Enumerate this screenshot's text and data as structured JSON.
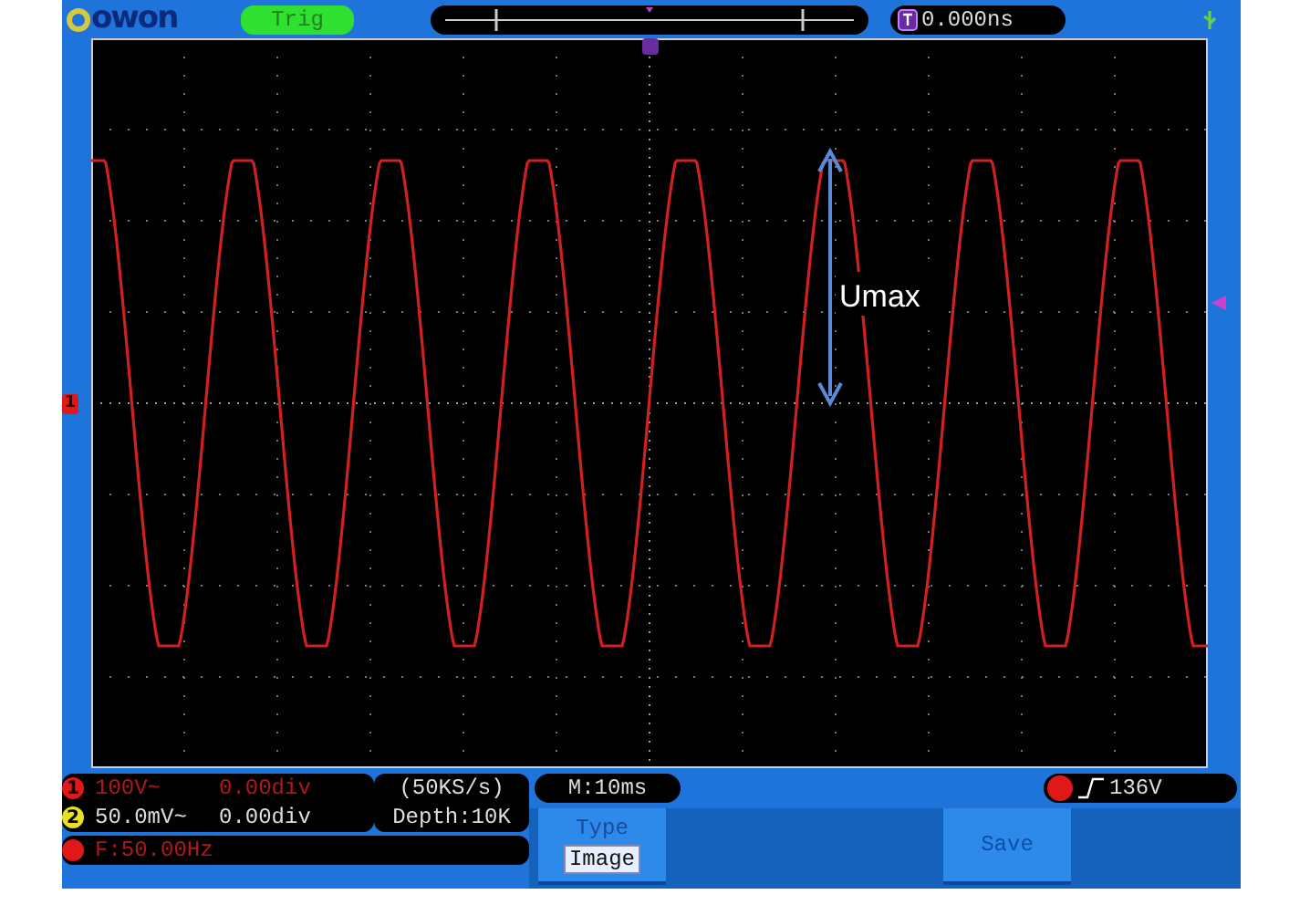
{
  "header": {
    "logo": "owon",
    "trigger_status": "Trig",
    "time_offset": "0.000ns"
  },
  "plot": {
    "annotation": "Umax",
    "channel_marker": "1"
  },
  "channels": [
    {
      "marker": "1",
      "color": "#e01818",
      "scale": "100V~",
      "offset": "0.00div"
    },
    {
      "marker": "2",
      "color": "#e8e020",
      "scale": "50.0mV~",
      "offset": "0.00div"
    }
  ],
  "frequency": "F:50.00Hz",
  "sample_rate": "(50KS/s)",
  "depth": "Depth:10K",
  "timebase": "M:10ms",
  "trigger_level": "136V",
  "menu": [
    {
      "kind": "option",
      "label": "Type",
      "value": "Image"
    },
    {
      "kind": "action",
      "label": "Save"
    }
  ]
}
